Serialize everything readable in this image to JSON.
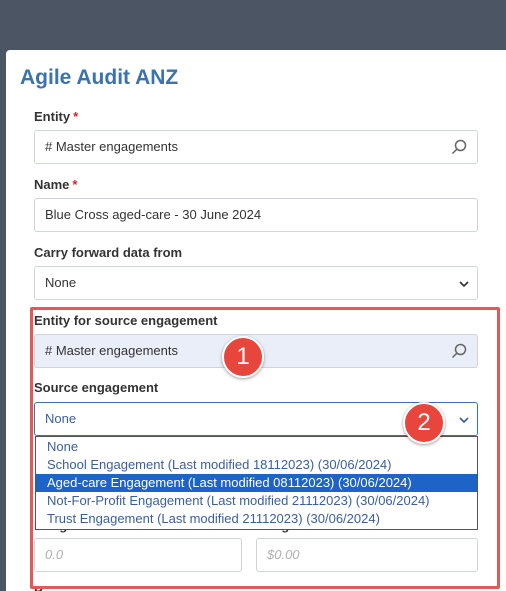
{
  "modal": {
    "title": "Agile Audit ANZ"
  },
  "fields": {
    "entity": {
      "label": "Entity",
      "required_mark": "*",
      "value": "# Master engagements"
    },
    "name": {
      "label": "Name",
      "required_mark": "*",
      "value": "Blue Cross aged-care - 30 June 2024"
    },
    "carry_forward": {
      "label": "Carry forward data from",
      "value": "None"
    },
    "entity_source": {
      "label": "Entity for source engagement",
      "value": "# Master engagements"
    },
    "source_engagement": {
      "label": "Source engagement",
      "value": "None",
      "options": [
        "None",
        "School Engagement (Last modified 18112023) (30/06/2024)",
        "Aged-care Engagement (Last modified 08112023) (30/06/2024)",
        "Not-For-Profit Engagement (Last modified 21112023) (30/06/2024)",
        "Trust Engagement (Last modified 21112023) (30/06/2024)"
      ],
      "highlighted_option_index": 2
    },
    "budget_hours": {
      "label": "Budget Hours",
      "placeholder": "0.0"
    },
    "budget_amount": {
      "label": "Budget Amount",
      "placeholder": "$0.00"
    },
    "next_label_partial": "P"
  },
  "annotations": {
    "badge_1": "1",
    "badge_2": "2",
    "callout_color": "#e05a5a",
    "badge_color": "#e8463c"
  },
  "colors": {
    "title": "#3a73ad",
    "selected_option_bg": "#1e63c6",
    "backdrop": "#4b5563"
  }
}
